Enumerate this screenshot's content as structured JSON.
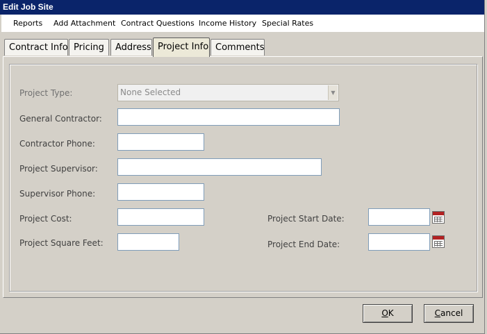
{
  "window": {
    "title": "Edit Job Site"
  },
  "menu": [
    "Reports",
    "Add Attachment",
    "Contract Questions",
    "Income History",
    "Special Rates"
  ],
  "tabs": [
    "Contract Info",
    "Pricing",
    "Address",
    "Project Info",
    "Comments"
  ],
  "active_tab": "Project Info",
  "form": {
    "project_type": {
      "label": "Project Type:",
      "value": "None Selected"
    },
    "general_contractor": {
      "label": "General Contractor:",
      "value": ""
    },
    "contractor_phone": {
      "label": "Contractor Phone:",
      "value": ""
    },
    "project_supervisor": {
      "label": "Project Supervisor:",
      "value": ""
    },
    "supervisor_phone": {
      "label": "Supervisor Phone:",
      "value": ""
    },
    "project_cost": {
      "label": "Project Cost:",
      "value": ""
    },
    "project_square_feet": {
      "label": "Project Square Feet:",
      "value": ""
    },
    "project_start_date": {
      "label": "Project Start Date:",
      "value": ""
    },
    "project_end_date": {
      "label": "Project End Date:",
      "value": ""
    }
  },
  "buttons": {
    "ok": {
      "accel": "O",
      "rest": "K"
    },
    "cancel": {
      "accel": "C",
      "rest": "ancel"
    }
  },
  "icons": {
    "calendar": "calendar-icon",
    "dropdown": "chevron-down-icon"
  },
  "colors": {
    "titlebar": "#0a246a",
    "calendar_accent": "#b22222"
  }
}
